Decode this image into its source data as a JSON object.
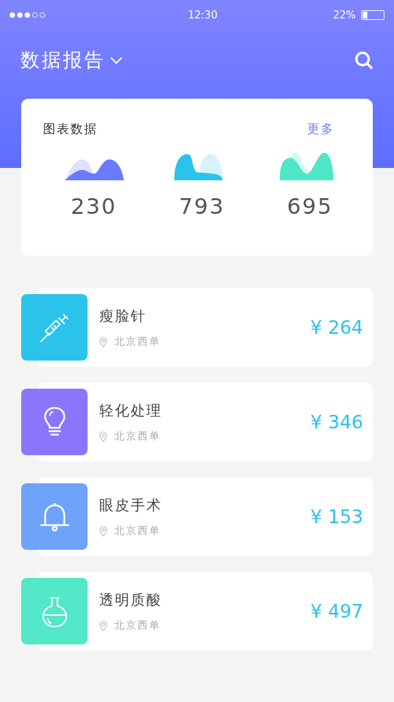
{
  "status_bar": {
    "signal_dots": [
      {
        "on": true
      },
      {
        "on": true
      },
      {
        "on": true
      },
      {
        "on": false
      },
      {
        "on": false
      }
    ],
    "time": "12:30",
    "battery": "22%"
  },
  "header": {
    "title": "数据报告"
  },
  "chart_card": {
    "title": "图表数据",
    "more": "更多",
    "stats": [
      {
        "value": "230",
        "color": "#6b7bff"
      },
      {
        "value": "793",
        "color": "#2cc3ea"
      },
      {
        "value": "695",
        "color": "#4fe6c8"
      }
    ]
  },
  "items": [
    {
      "kind": "syringe",
      "color": "#2cc3ea",
      "name": "瘦脸针",
      "location": "北京西单",
      "price": "¥ 264"
    },
    {
      "kind": "bulb",
      "color": "#8a76fb",
      "name": "轻化处理",
      "location": "北京西单",
      "price": "¥ 346"
    },
    {
      "kind": "bell",
      "color": "#6fa3fb",
      "name": "眼皮手术",
      "location": "北京西单",
      "price": "¥ 153"
    },
    {
      "kind": "flask",
      "color": "#52e8c8",
      "name": "透明质酸",
      "location": "北京西单",
      "price": "¥ 497"
    }
  ]
}
